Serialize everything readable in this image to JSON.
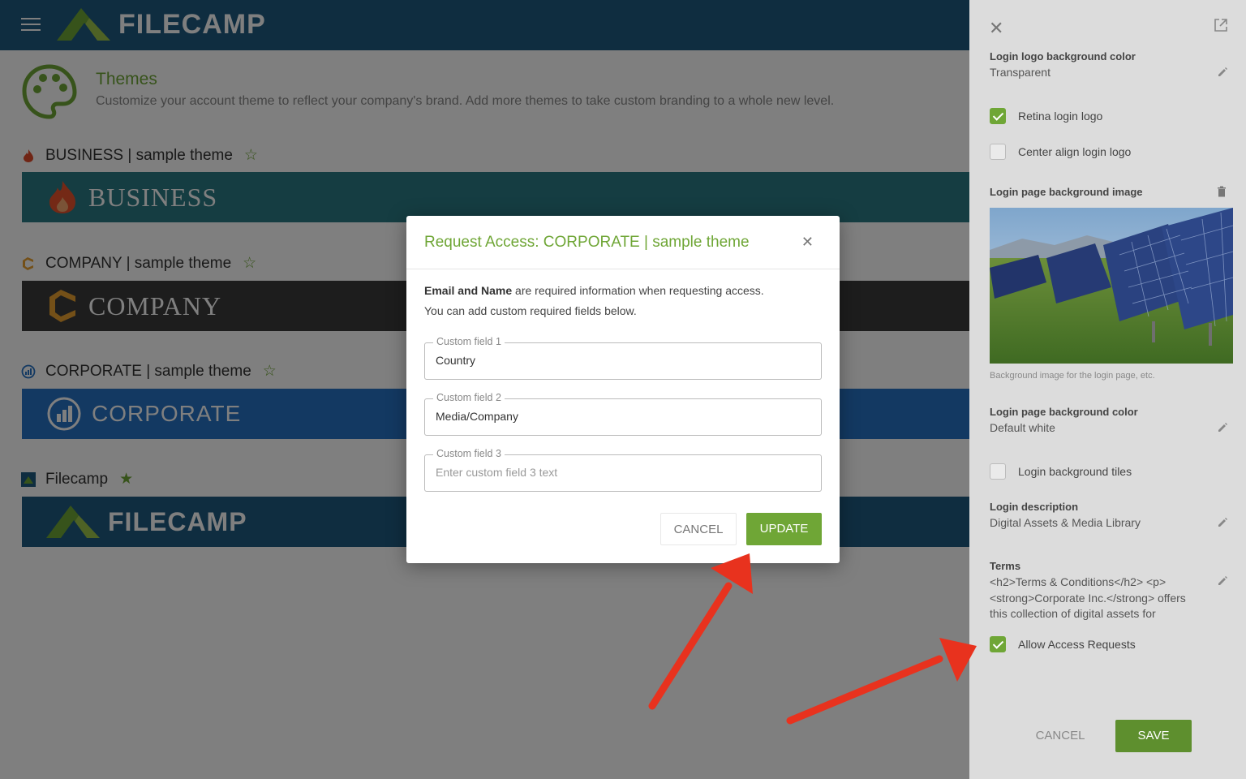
{
  "app": {
    "brand": "FILECAMP"
  },
  "page": {
    "title": "Themes",
    "description": "Customize your account theme to reflect your company's brand. Add more themes to take custom branding to a whole new level."
  },
  "themes": [
    {
      "name": "BUSINESS | sample theme",
      "banner": "BUSINESS",
      "banner_color": "#2b7a84",
      "starred": false
    },
    {
      "name": "COMPANY | sample theme",
      "banner": "COMPANY",
      "banner_color": "#3a3a3a",
      "starred": false
    },
    {
      "name": "CORPORATE | sample theme",
      "banner": "CORPORATE",
      "banner_color": "#2672c4",
      "starred": false
    },
    {
      "name": "Filecamp",
      "banner": "FILECAMP",
      "banner_color": "#1e5a80",
      "starred": true
    }
  ],
  "panel": {
    "logo_bg_label": "Login logo background color",
    "logo_bg_value": "Transparent",
    "retina_label": "Retina login logo",
    "retina_checked": true,
    "center_label": "Center align login logo",
    "center_checked": false,
    "bg_image_label": "Login page background image",
    "bg_image_caption": "Background image for the login page, etc.",
    "bg_color_label": "Login page background color",
    "bg_color_value": "Default white",
    "tiles_label": "Login background tiles",
    "tiles_checked": false,
    "desc_label": "Login description",
    "desc_value": "Digital Assets & Media Library",
    "terms_label": "Terms",
    "terms_value": "<h2>Terms & Conditions</h2> <p> <strong>Corporate Inc.</strong> offers this collection of digital assets for",
    "access_label": "Allow Access Requests",
    "access_checked": true,
    "cancel": "CANCEL",
    "save": "SAVE"
  },
  "modal": {
    "title": "Request Access: CORPORATE | sample theme",
    "info_bold": "Email and Name",
    "info_rest": " are required information when requesting access.",
    "info_line2": "You can add custom required fields below.",
    "fields": [
      {
        "label": "Custom field 1",
        "value": "Country",
        "placeholder": ""
      },
      {
        "label": "Custom field 2",
        "value": "Media/Company",
        "placeholder": ""
      },
      {
        "label": "Custom field 3",
        "value": "",
        "placeholder": "Enter custom field 3 text"
      }
    ],
    "cancel": "CANCEL",
    "update": "UPDATE"
  },
  "colors": {
    "accent": "#6fa636",
    "topbar": "#1e5a80",
    "arrow": "#e8321e"
  }
}
